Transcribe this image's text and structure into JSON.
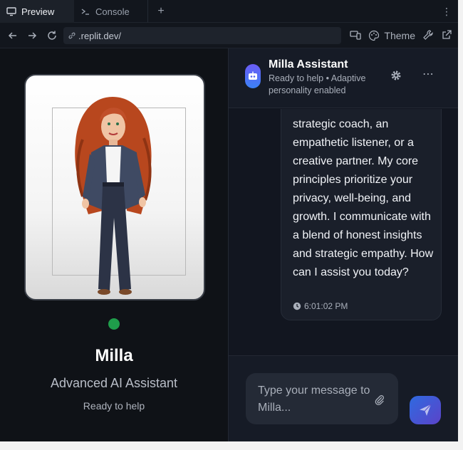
{
  "browser": {
    "tabs": [
      {
        "label": "Preview",
        "icon": "monitor-icon"
      },
      {
        "label": "Console",
        "icon": "terminal-icon"
      }
    ],
    "url": ".replit.dev/",
    "theme_label": "Theme"
  },
  "profile": {
    "name": "Milla",
    "subtitle": "Advanced AI Assistant",
    "status": "Ready to help",
    "status_color": "#1f9d4b"
  },
  "chat": {
    "title": "Milla Assistant",
    "status": "Ready to help • Adaptive personality enabled",
    "messages": [
      {
        "text": "strategic coach, an empathetic listener, or a creative partner. My core principles prioritize your privacy, well-being, and growth. I communicate with a blend of honest insights and strategic empathy. How can I assist you today?",
        "time": "6:01:02 PM"
      }
    ],
    "input_placeholder": "Type your message to Milla..."
  },
  "colors": {
    "accent_gradient_start": "#2f6ae0",
    "accent_gradient_end": "#5b43c9",
    "background": "#0e1116"
  }
}
